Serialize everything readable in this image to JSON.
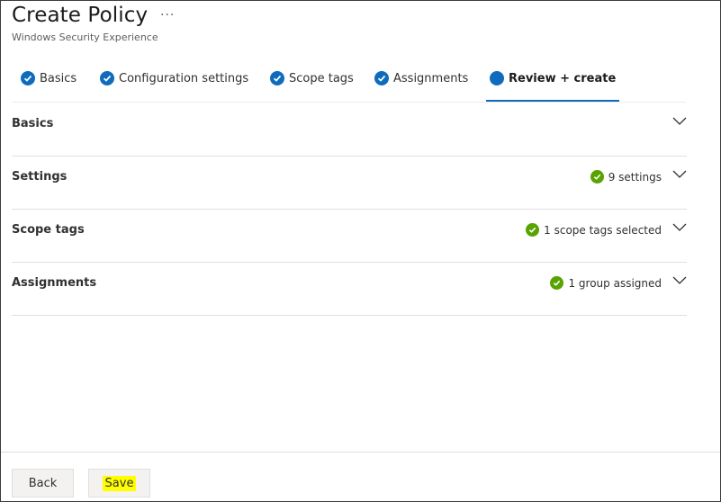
{
  "header": {
    "title": "Create Policy",
    "more": "···",
    "subtitle": "Windows Security Experience"
  },
  "tabs": [
    {
      "label": "Basics",
      "state": "completed"
    },
    {
      "label": "Configuration settings",
      "state": "completed"
    },
    {
      "label": "Scope tags",
      "state": "completed"
    },
    {
      "label": "Assignments",
      "state": "completed"
    },
    {
      "label": "Review + create",
      "state": "active"
    }
  ],
  "sections": [
    {
      "title": "Basics",
      "summary": ""
    },
    {
      "title": "Settings",
      "summary": "9 settings"
    },
    {
      "title": "Scope tags",
      "summary": "1 scope tags selected"
    },
    {
      "title": "Assignments",
      "summary": "1 group assigned"
    }
  ],
  "footer": {
    "back_label": "Back",
    "save_label": "Save"
  },
  "colors": {
    "accent": "#0f6cbd",
    "success": "#57a300",
    "highlight": "#ffff00"
  },
  "icons": {
    "tab_complete": "checkmark-circle-icon",
    "tab_active": "filled-circle-icon",
    "section_status": "success-check-icon",
    "expand": "chevron-down-icon",
    "more": "more-ellipsis-icon"
  }
}
